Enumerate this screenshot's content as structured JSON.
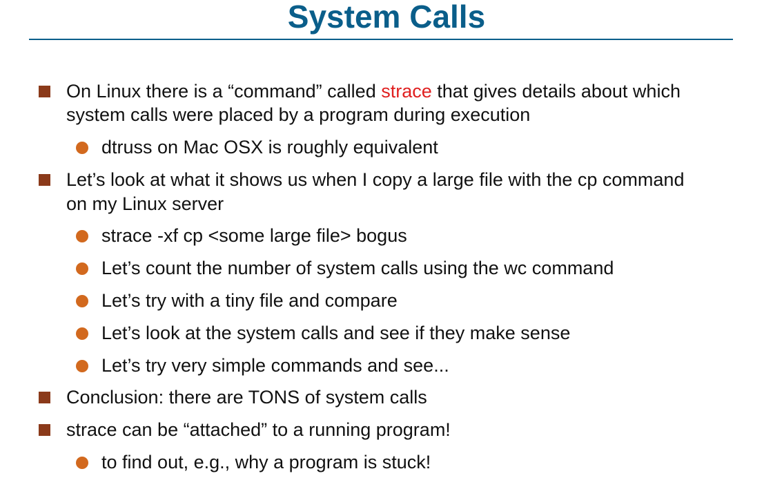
{
  "slide": {
    "title": "System Calls",
    "accent_color": "#0a5e8a",
    "highlight_color": "#e02020",
    "bullets": {
      "b1": {
        "pre": "On Linux there is a “command” called ",
        "highlight": "strace",
        "post": " that gives details about which",
        "line2": "system calls were placed by a program during execution"
      },
      "b1_sub1": "dtruss on Mac OSX is roughly equivalent",
      "b2": {
        "line1": "Let’s look at what it shows us when I copy a large file with the cp command",
        "line2": "on my Linux server"
      },
      "b2_sub1": "strace -xf cp <some large file> bogus",
      "b2_sub2": "Let’s count the number of system calls using the wc command",
      "b2_sub3": "Let’s try with a tiny file and compare",
      "b2_sub4": "Let’s look at the system calls and see if they make sense",
      "b2_sub5": "Let’s try very simple commands and see...",
      "b3": "Conclusion: there are TONS of system calls",
      "b4": "strace can be “attached” to a running program!",
      "b4_sub1": "to find out, e.g., why a program is stuck!"
    }
  }
}
